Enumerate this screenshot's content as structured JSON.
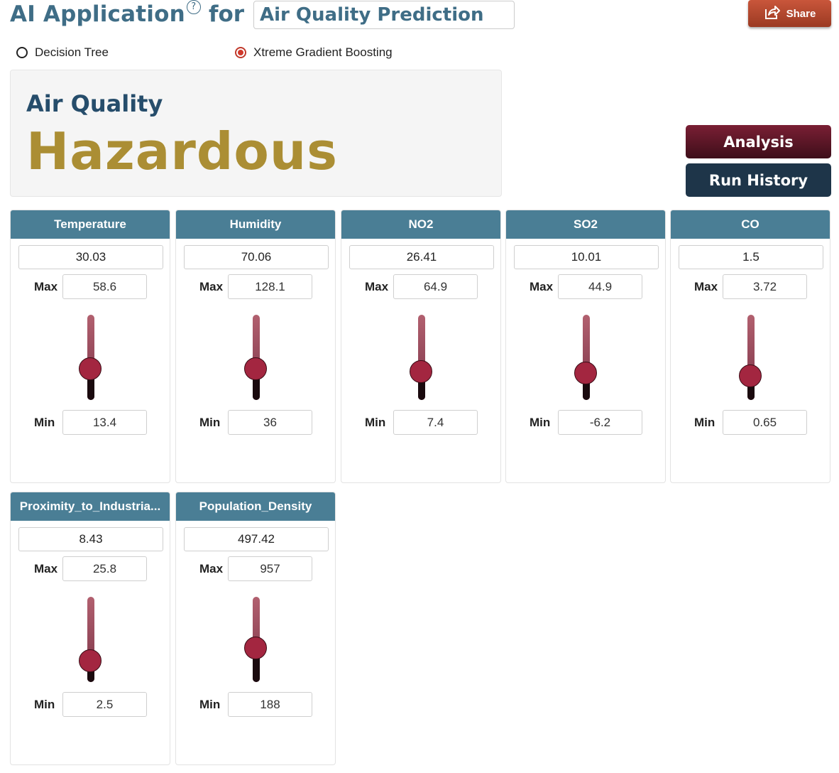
{
  "header": {
    "title": "AI Application",
    "help_glyph": "?",
    "for_label": "for",
    "app_name": "Air Quality Prediction",
    "share_label": "Share"
  },
  "models": [
    {
      "label": "Decision Tree",
      "selected": false
    },
    {
      "label": "Xtreme Gradient Boosting",
      "selected": true
    }
  ],
  "result": {
    "label": "Air Quality",
    "value": "Hazardous",
    "value_color": "#ab8e34"
  },
  "actions": {
    "analysis_label": "Analysis",
    "history_label": "Run History"
  },
  "range_labels": {
    "max": "Max",
    "min": "Min"
  },
  "features": [
    {
      "name": "Temperature",
      "value": "30.03",
      "max": "58.6",
      "min": "13.4",
      "level": 0.37
    },
    {
      "name": "Humidity",
      "value": "70.06",
      "max": "128.1",
      "min": "36",
      "level": 0.37
    },
    {
      "name": "NO2",
      "value": "26.41",
      "max": "64.9",
      "min": "7.4",
      "level": 0.33
    },
    {
      "name": "SO2",
      "value": "10.01",
      "max": "44.9",
      "min": "-6.2",
      "level": 0.32
    },
    {
      "name": "CO",
      "value": "1.5",
      "max": "3.72",
      "min": "0.65",
      "level": 0.28
    },
    {
      "name": "Proximity_to_Industria...",
      "value": "8.43",
      "max": "25.8",
      "min": "2.5",
      "level": 0.25
    },
    {
      "name": "Population_Density",
      "value": "497.42",
      "max": "957",
      "min": "188",
      "level": 0.4
    }
  ],
  "colors": {
    "accent": "#3f6d86",
    "card_header": "#4a7e95",
    "analysis_button": "#5a1626",
    "history_button": "#1e3549",
    "slider_thumb": "#a32640"
  }
}
